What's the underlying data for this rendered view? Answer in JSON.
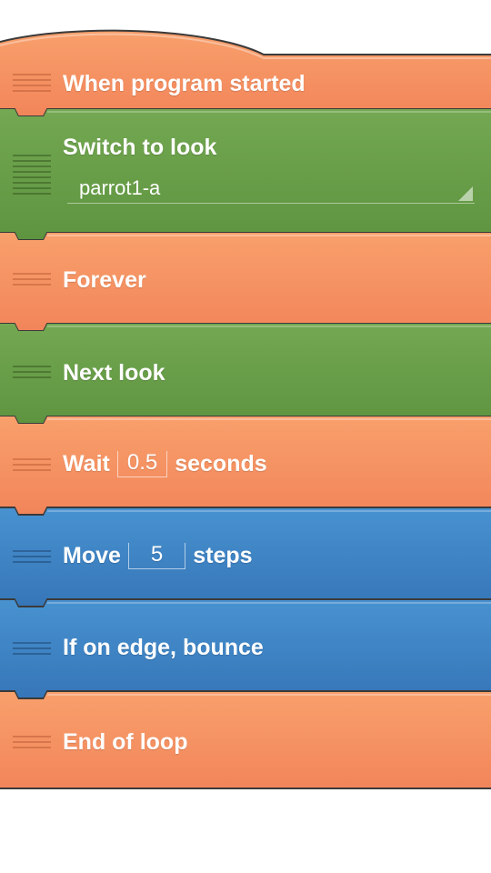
{
  "bricks": [
    {
      "id": "when-program-started",
      "label": "When program started",
      "category": "event"
    },
    {
      "id": "switch-to-look",
      "label": "Switch to look",
      "category": "looks",
      "dropdown_value": "parrot1-a"
    },
    {
      "id": "forever",
      "label": "Forever",
      "category": "control"
    },
    {
      "id": "next-look",
      "label": "Next look",
      "category": "looks"
    },
    {
      "id": "wait",
      "label_before": "Wait",
      "value": "0.5",
      "label_after": "seconds",
      "category": "control"
    },
    {
      "id": "move-steps",
      "label_before": "Move",
      "value": "5",
      "label_after": "steps",
      "category": "motion"
    },
    {
      "id": "if-on-edge-bounce",
      "label": "If on edge, bounce",
      "category": "motion"
    },
    {
      "id": "end-of-loop",
      "label": "End of loop",
      "category": "control"
    }
  ],
  "colors": {
    "control_top": "#f79a67",
    "control_bottom": "#f2855a",
    "looks_top": "#72a64e",
    "looks_bottom": "#5e9440",
    "motion_top": "#4790cf",
    "motion_bottom": "#3778b9",
    "outline": "#3a3a3a",
    "background": "#ffffff"
  }
}
